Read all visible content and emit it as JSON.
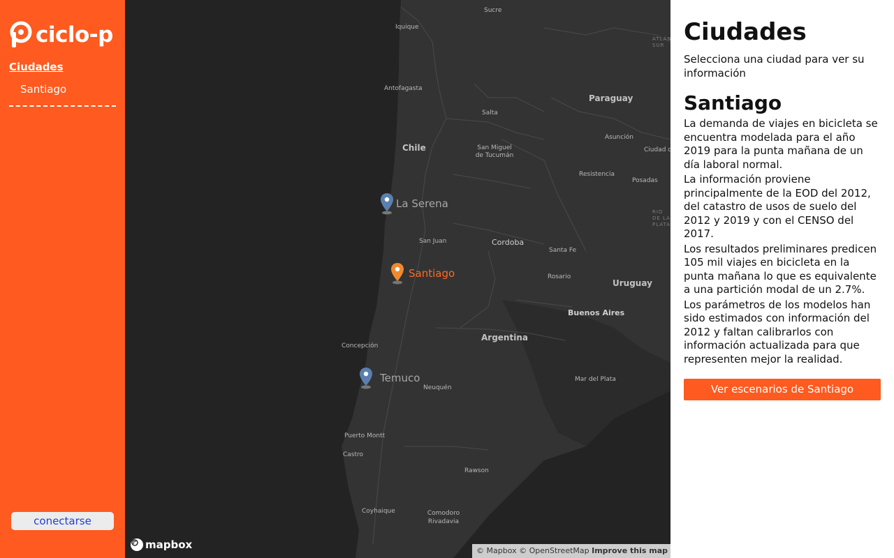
{
  "app": {
    "logo_text": "ciclo-p",
    "accent_color": "#ff5a1f"
  },
  "sidebar": {
    "heading": "Ciudades",
    "items": [
      {
        "label": "Santiago"
      }
    ],
    "connect_label": "conectarse"
  },
  "map": {
    "countries": [
      "Chile",
      "Paraguay",
      "Argentina",
      "Uruguay"
    ],
    "places": [
      "Sucre",
      "Iquique",
      "Antofagasta",
      "Salta",
      "Asunción",
      "San Miguel de Tucumán",
      "Resistencia",
      "Posadas",
      "Ciudad de",
      "Cordoba",
      "San Juan",
      "Santa Fe",
      "Rosario",
      "Buenos Aires",
      "Concepción",
      "Neuquén",
      "Mar del Plata",
      "Puerto Montt",
      "Castro",
      "Rawson",
      "Coyhaique",
      "Comodoro Rivadavia"
    ],
    "ocean_labels": [
      "ATLÁNTICO SUR",
      "RIO DE LA PLATA"
    ],
    "pins": [
      {
        "label": "La Serena",
        "active": false,
        "color": "#5b7fae"
      },
      {
        "label": "Santiago",
        "active": true,
        "color": "#f08a2d"
      },
      {
        "label": "Temuco",
        "active": false,
        "color": "#5b7fae"
      }
    ],
    "brand": "mapbox",
    "attribution": {
      "mapbox": "© Mapbox",
      "osm": "© OpenStreetMap",
      "improve": "Improve this map"
    }
  },
  "panel": {
    "title": "Ciudades",
    "intro": "Selecciona una ciudad para ver su información",
    "city_title": "Santiago",
    "paragraphs": [
      "La demanda de viajes en bicicleta se encuentra modelada para el año 2019 para la punta mañana de un día laboral normal.",
      "La información proviene principalmente de la EOD del 2012, del catastro de usos de suelo del 2012 y 2019 y con el CENSO del 2017.",
      "Los resultados preliminares predicen 105 mil viajes en bicicleta en la punta mañana lo que es equivalente a una partición modal de un 2.7%.",
      "Los parámetros de los modelos han sido estimados con información del 2012 y faltan calibrarlos con información actualizada para que representen mejor la realidad."
    ],
    "button_label": "Ver escenarios de Santiago"
  }
}
